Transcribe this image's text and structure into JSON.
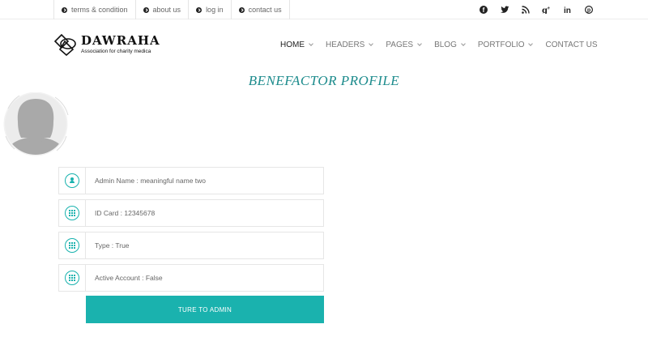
{
  "topbar": {
    "links": [
      {
        "label": "terms & condition",
        "icon": "arrow-circle-icon"
      },
      {
        "label": "about us",
        "icon": "arrow-circle-icon"
      },
      {
        "label": "log in",
        "icon": "arrow-circle-icon"
      },
      {
        "label": "contact us",
        "icon": "arrow-circle-icon"
      }
    ],
    "socials": [
      {
        "name": "facebook-icon",
        "glyph": "f"
      },
      {
        "name": "twitter-icon",
        "glyph": "🐦"
      },
      {
        "name": "rss-icon",
        "glyph": "≈"
      },
      {
        "name": "google-plus-icon",
        "glyph": "g+"
      },
      {
        "name": "linkedin-icon",
        "glyph": "in"
      },
      {
        "name": "pinterest-icon",
        "glyph": "℗"
      }
    ]
  },
  "header": {
    "logo_title": "DAWRAHA",
    "logo_subtitle": "Association for charity medica"
  },
  "nav": {
    "items": [
      {
        "label": "HOME",
        "has_dropdown": true,
        "active": true
      },
      {
        "label": "HEADERS",
        "has_dropdown": true,
        "active": false
      },
      {
        "label": "PAGES",
        "has_dropdown": true,
        "active": false
      },
      {
        "label": "BLOG",
        "has_dropdown": true,
        "active": false
      },
      {
        "label": "PORTFOLIO",
        "has_dropdown": true,
        "active": false
      },
      {
        "label": "CONTACT US",
        "has_dropdown": false,
        "active": false
      }
    ]
  },
  "page": {
    "title": "BENEFACTOR PROFILE"
  },
  "profile": {
    "fields": [
      {
        "icon": "user-icon",
        "text": "Admin Name : meaningful name two"
      },
      {
        "icon": "grid-icon",
        "text": "ID Card : 12345678"
      },
      {
        "icon": "grid-icon",
        "text": "Type : True"
      },
      {
        "icon": "grid-icon",
        "text": "Active Account : False"
      }
    ],
    "action_label": "TURE TO ADMIN"
  },
  "colors": {
    "accent": "#1ab2ae",
    "title": "#1c8b8c"
  }
}
